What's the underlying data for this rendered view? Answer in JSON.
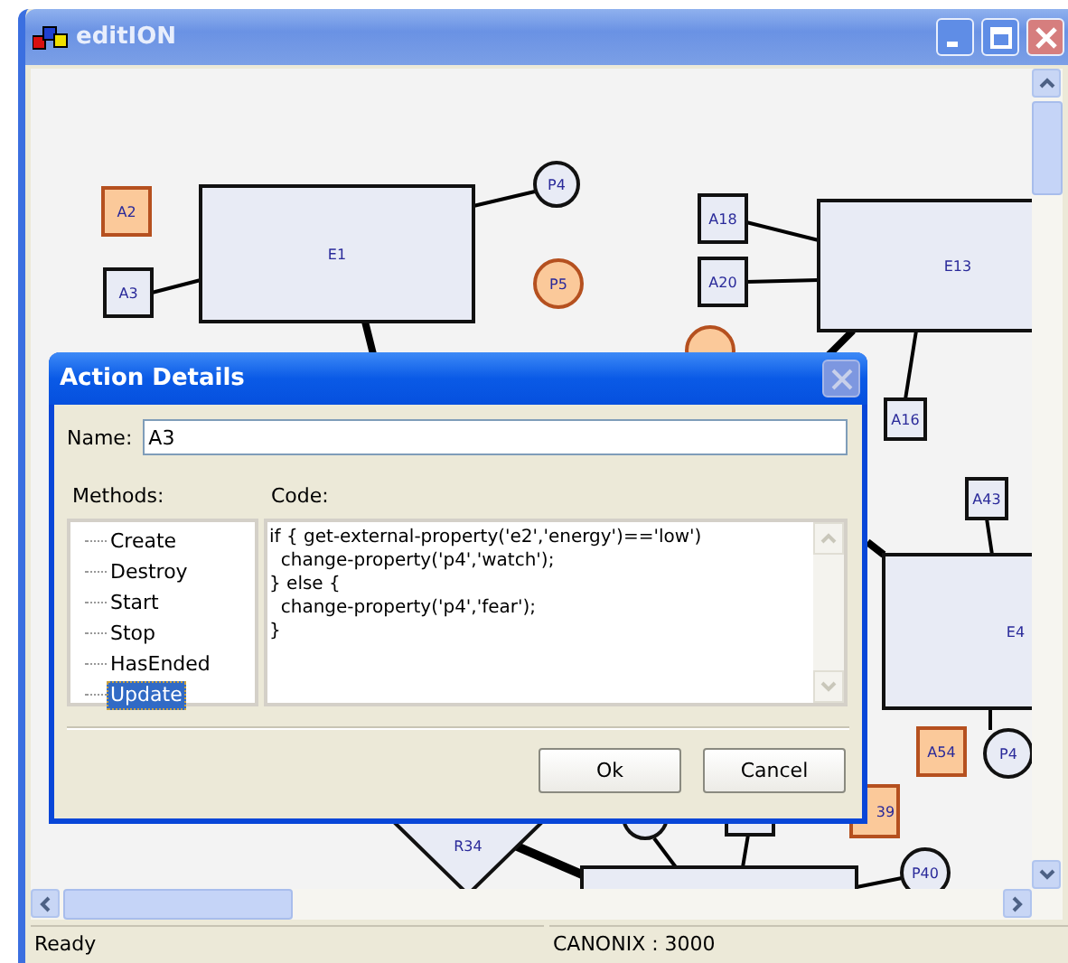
{
  "window": {
    "title": "editION"
  },
  "diagram": {
    "nodes": [
      {
        "kind": "action",
        "label": "A2",
        "highlighted": true
      },
      {
        "kind": "action",
        "label": "A3",
        "highlighted": false
      },
      {
        "kind": "entity",
        "label": "E1",
        "highlighted": false
      },
      {
        "kind": "property",
        "label": "P4",
        "highlighted": false
      },
      {
        "kind": "property",
        "label": "P5",
        "highlighted": true
      },
      {
        "kind": "action",
        "label": "A18",
        "highlighted": false
      },
      {
        "kind": "action",
        "label": "A20",
        "highlighted": false
      },
      {
        "kind": "entity",
        "label": "E13",
        "highlighted": false
      },
      {
        "kind": "property",
        "highlighted": true
      },
      {
        "kind": "action",
        "label": "A16",
        "highlighted": false
      },
      {
        "kind": "action",
        "label": "A43",
        "highlighted": false
      },
      {
        "kind": "entity",
        "label": "E4",
        "highlighted": false
      },
      {
        "kind": "action",
        "label": "A54",
        "highlighted": true
      },
      {
        "kind": "property",
        "label": "P4",
        "highlighted": false
      },
      {
        "kind": "action",
        "label": "39",
        "highlighted": true
      },
      {
        "kind": "property",
        "highlighted": false
      },
      {
        "kind": "action",
        "highlighted": false
      },
      {
        "kind": "role",
        "label": "R34",
        "highlighted": false
      },
      {
        "kind": "entity",
        "highlighted": false
      },
      {
        "kind": "property",
        "label": "P40",
        "highlighted": false
      }
    ]
  },
  "dialog": {
    "title": "Action Details",
    "name_label": "Name:",
    "name_value": "A3",
    "methods_label": "Methods:",
    "code_label": "Code:",
    "methods": [
      {
        "label": "Create",
        "selected": false
      },
      {
        "label": "Destroy",
        "selected": false
      },
      {
        "label": "Start",
        "selected": false
      },
      {
        "label": "Stop",
        "selected": false
      },
      {
        "label": "HasEnded",
        "selected": false
      },
      {
        "label": "Update",
        "selected": true
      }
    ],
    "code": [
      "if { get-external-property('e2','energy')=='low')",
      "  change-property('p4','watch');",
      "} else {",
      "  change-property('p4','fear');",
      "}"
    ],
    "buttons": [
      "Ok",
      "Cancel"
    ]
  },
  "status_bar": [
    "Ready",
    "CANONIX : 3000"
  ]
}
